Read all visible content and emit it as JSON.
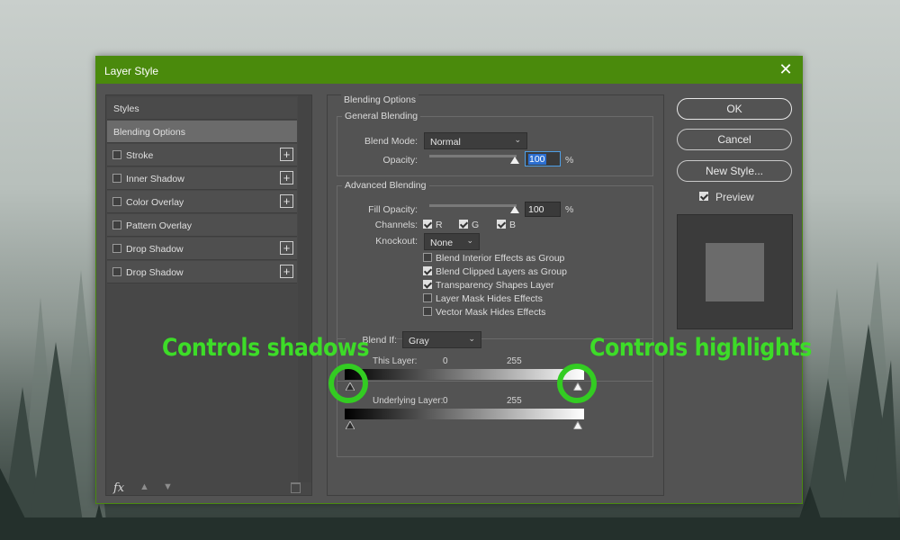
{
  "window": {
    "title": "Layer Style",
    "close_icon": "close-icon"
  },
  "styles_list": {
    "header": "Styles",
    "items": [
      {
        "label": "Blending Options",
        "selected": true,
        "has_checkbox": false,
        "has_plus": false
      },
      {
        "label": "Stroke",
        "checked": false,
        "has_checkbox": true,
        "has_plus": true
      },
      {
        "label": "Inner Shadow",
        "checked": false,
        "has_checkbox": true,
        "has_plus": true
      },
      {
        "label": "Color Overlay",
        "checked": false,
        "has_checkbox": true,
        "has_plus": true
      },
      {
        "label": "Pattern Overlay",
        "checked": false,
        "has_checkbox": true,
        "has_plus": false
      },
      {
        "label": "Drop Shadow",
        "checked": false,
        "has_checkbox": true,
        "has_plus": true
      },
      {
        "label": "Drop Shadow",
        "checked": false,
        "has_checkbox": true,
        "has_plus": true
      }
    ],
    "plus_glyph": "+",
    "fx_label": "fx",
    "icons": [
      "fx-icon",
      "move-up-icon",
      "move-down-icon",
      "trash-icon"
    ]
  },
  "blending_options": {
    "section_title": "Blending Options",
    "general": {
      "title": "General Blending",
      "blend_mode_label": "Blend Mode:",
      "blend_mode_value": "Normal",
      "opacity_label": "Opacity:",
      "opacity_value": "100",
      "opacity_percent": 100,
      "percent_sign": "%"
    },
    "advanced": {
      "title": "Advanced Blending",
      "fill_opacity_label": "Fill Opacity:",
      "fill_opacity_value": "100",
      "fill_opacity_percent": 100,
      "percent_sign": "%",
      "channels_label": "Channels:",
      "channels": [
        {
          "label": "R",
          "checked": true
        },
        {
          "label": "G",
          "checked": true
        },
        {
          "label": "B",
          "checked": true
        }
      ],
      "knockout_label": "Knockout:",
      "knockout_value": "None",
      "options": [
        {
          "label": "Blend Interior Effects as Group",
          "checked": false
        },
        {
          "label": "Blend Clipped Layers as Group",
          "checked": true
        },
        {
          "label": "Transparency Shapes Layer",
          "checked": true
        },
        {
          "label": "Layer Mask Hides Effects",
          "checked": false
        },
        {
          "label": "Vector Mask Hides Effects",
          "checked": false
        }
      ]
    },
    "blend_if": {
      "label": "Blend If:",
      "value": "Gray",
      "this_layer_label": "This Layer:",
      "this_layer_min": "0",
      "this_layer_max": "255",
      "underlying_label": "Underlying Layer:",
      "underlying_min": "0",
      "underlying_max": "255"
    }
  },
  "buttons": {
    "ok": "OK",
    "cancel": "Cancel",
    "new_style": "New Style...",
    "preview_label": "Preview",
    "preview_checked": true
  },
  "annotations": {
    "shadows": "Controls shadows",
    "highlights": "Controls highlights",
    "color": "#3ddc28"
  },
  "colors": {
    "titlebar": "#4a8a0c",
    "panel": "#535353",
    "focus": "#2c6fd1"
  }
}
